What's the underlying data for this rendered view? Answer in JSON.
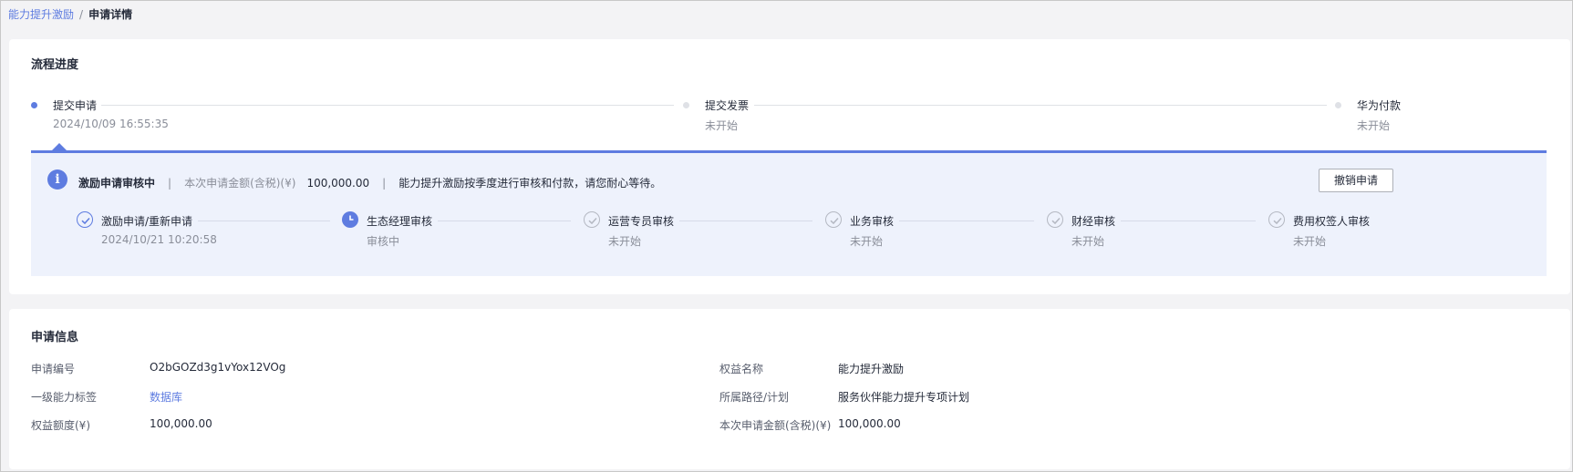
{
  "breadcrumb": {
    "parent": "能力提升激励",
    "separator": "/",
    "current": "申请详情"
  },
  "progress": {
    "title": "流程进度",
    "steps": [
      {
        "name": "提交申请",
        "sub": "2024/10/09 16:55:35"
      },
      {
        "name": "提交发票",
        "sub": "未开始"
      },
      {
        "name": "华为付款",
        "sub": "未开始"
      }
    ],
    "panel": {
      "status": "激励申请审核中",
      "divider": "|",
      "amount_label": "本次申请金额(含税)(¥)",
      "amount_value": "100,000.00",
      "notice": "能力提升激励按季度进行审核和付款，请您耐心等待。",
      "cancel_label": "撤销申请",
      "steps": [
        {
          "name": "激励申请/重新申请",
          "sub": "2024/10/21 10:20:58",
          "state": "done"
        },
        {
          "name": "生态经理审核",
          "sub": "审核中",
          "state": "current"
        },
        {
          "name": "运营专员审核",
          "sub": "未开始",
          "state": "todo"
        },
        {
          "name": "业务审核",
          "sub": "未开始",
          "state": "todo"
        },
        {
          "name": "财经审核",
          "sub": "未开始",
          "state": "todo"
        },
        {
          "name": "费用权签人审核",
          "sub": "未开始",
          "state": "todo"
        }
      ]
    }
  },
  "info": {
    "title": "申请信息",
    "left": [
      {
        "label": "申请编号",
        "value": "O2bGOZd3g1vYox12VOg"
      },
      {
        "label": "一级能力标签",
        "value": "数据库"
      },
      {
        "label": "权益额度(¥)",
        "value": "100,000.00"
      }
    ],
    "right": [
      {
        "label": "权益名称",
        "value": "能力提升激励"
      },
      {
        "label": "所属路径/计划",
        "value": "服务伙伴能力提升专项计划"
      },
      {
        "label": "本次申请金额(含税)(¥)",
        "value": "100,000.00"
      }
    ]
  },
  "colors": {
    "accent": "#5e7ce0",
    "panel_bg": "#eef2fc",
    "muted": "#8a8e99"
  }
}
